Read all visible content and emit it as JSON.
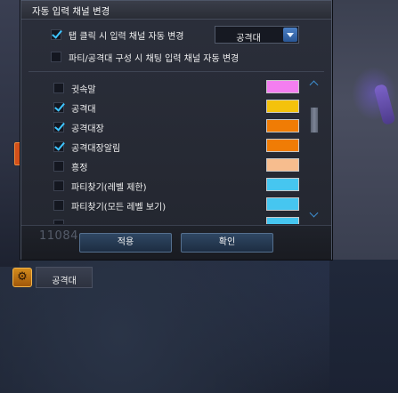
{
  "dialog": {
    "title": "자동 입력 채널 변경",
    "options": [
      {
        "label": "탭 클릭 시 입력 채널 자동 변경",
        "checked": true
      },
      {
        "label": "파티/공격대 구성 시 채팅 입력 채널 자동 변경",
        "checked": false
      }
    ],
    "dropdown": {
      "selected": "공격대"
    },
    "channels": [
      {
        "name": "귓속말",
        "checked": false,
        "color": "#f47ef0"
      },
      {
        "name": "공격대",
        "checked": true,
        "color": "#f4c20c"
      },
      {
        "name": "공격대장",
        "checked": true,
        "color": "#f07c05"
      },
      {
        "name": "공격대장알림",
        "checked": true,
        "color": "#f07c05"
      },
      {
        "name": "흥정",
        "checked": false,
        "color": "#f7bd8e"
      },
      {
        "name": "파티찾기(레벨 제한)",
        "checked": false,
        "color": "#46c6f0"
      },
      {
        "name": "파티찾기(모든 레벨 보기)",
        "checked": false,
        "color": "#46c6f0"
      }
    ],
    "background_number": "11084",
    "buttons": {
      "apply": "적용",
      "ok": "확인"
    }
  },
  "chat": {
    "tab_label": "공격대",
    "settings_icon": "gear-icon"
  }
}
